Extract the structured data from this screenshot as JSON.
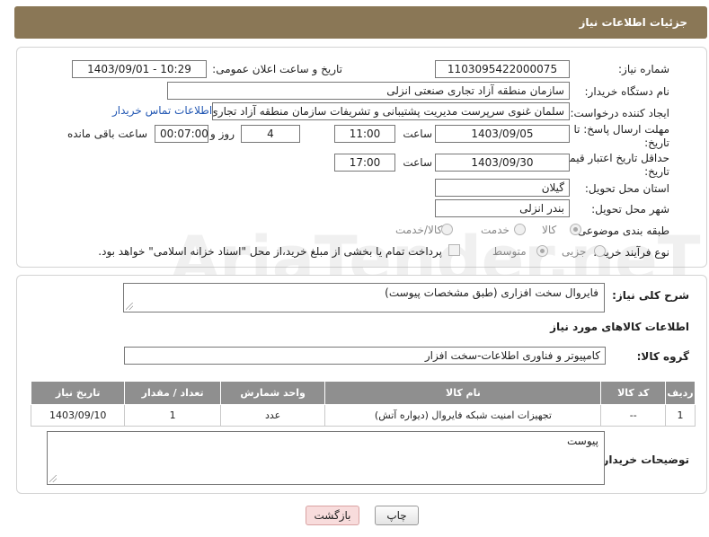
{
  "header": {
    "title": "جزئیات اطلاعات نیاز"
  },
  "watermark": {
    "text": "AriaTender.neT"
  },
  "form": {
    "need_number_label": "شماره نیاز:",
    "need_number": "1103095422000075",
    "announce_label": "تاریخ و ساعت اعلان عمومی:",
    "announce_value": "1403/09/01 - 10:29",
    "buyer_label": "نام دستگاه خریدار:",
    "buyer_value": "سازمان منطقه آزاد تجاری  صنعتی انزلی",
    "creator_label": "ایجاد کننده درخواست:",
    "creator_value": "سلمان غنوی سرپرست مدیریت پشتیبانی و تشریفات سازمان منطقه آزاد تجاری",
    "contact_link": "اطلاعات تماس خریدار",
    "deadline_label_1": "مهلت ارسال پاسخ: تا",
    "deadline_label_2": "تاریخ:",
    "deadline_date": "1403/09/05",
    "time_label": "ساعت",
    "deadline_time": "11:00",
    "days_value": "4",
    "days_label": "روز و",
    "remaining_time": "00:07:00",
    "remaining_label": "ساعت باقی مانده",
    "validity_label_1": "حداقل تاریخ اعتبار قیمت: تا",
    "validity_label_2": "تاریخ:",
    "validity_date": "1403/09/30",
    "validity_time_label": "ساعت",
    "validity_time": "17:00",
    "province_label": "استان محل تحویل:",
    "province_value": "گیلان",
    "city_label": "شهر محل تحویل:",
    "city_value": "بندر انزلی",
    "category_label": "طبقه بندی موضوعی:",
    "category_options": [
      "کالا",
      "خدمت",
      "کالا/خدمت"
    ],
    "process_label": "نوع فرآیند خرید :",
    "process_options": [
      "جزیی",
      "متوسط"
    ],
    "payment_note": "پرداخت تمام یا بخشی از مبلغ خرید،از محل \"اسناد خزانه اسلامی\" خواهد بود."
  },
  "details": {
    "summary_label": "شرح کلی نیاز:",
    "summary_value": "فایروال سخت افزاری (طبق مشخصات پیوست)",
    "goods_info_title": "اطلاعات کالاهای مورد نیاز",
    "goods_group_label": "گروه کالا:",
    "goods_group_value": "کامپیوتر و فناوری اطلاعات-سخت افزار",
    "table": {
      "headers": [
        "ردیف",
        "کد کالا",
        "نام کالا",
        "واحد شمارش",
        "تعداد / مقدار",
        "تاریخ نیاز"
      ],
      "rows": [
        [
          "1",
          "--",
          "تجهیزات امنیت شبکه فایروال (دیواره آتش)",
          "عدد",
          "1",
          "1403/09/10"
        ]
      ]
    },
    "buyer_notes_label": "توضیحات خریدار:",
    "buyer_notes_value": "پیوست"
  },
  "buttons": {
    "print": "چاپ",
    "back": "بازگشت"
  }
}
